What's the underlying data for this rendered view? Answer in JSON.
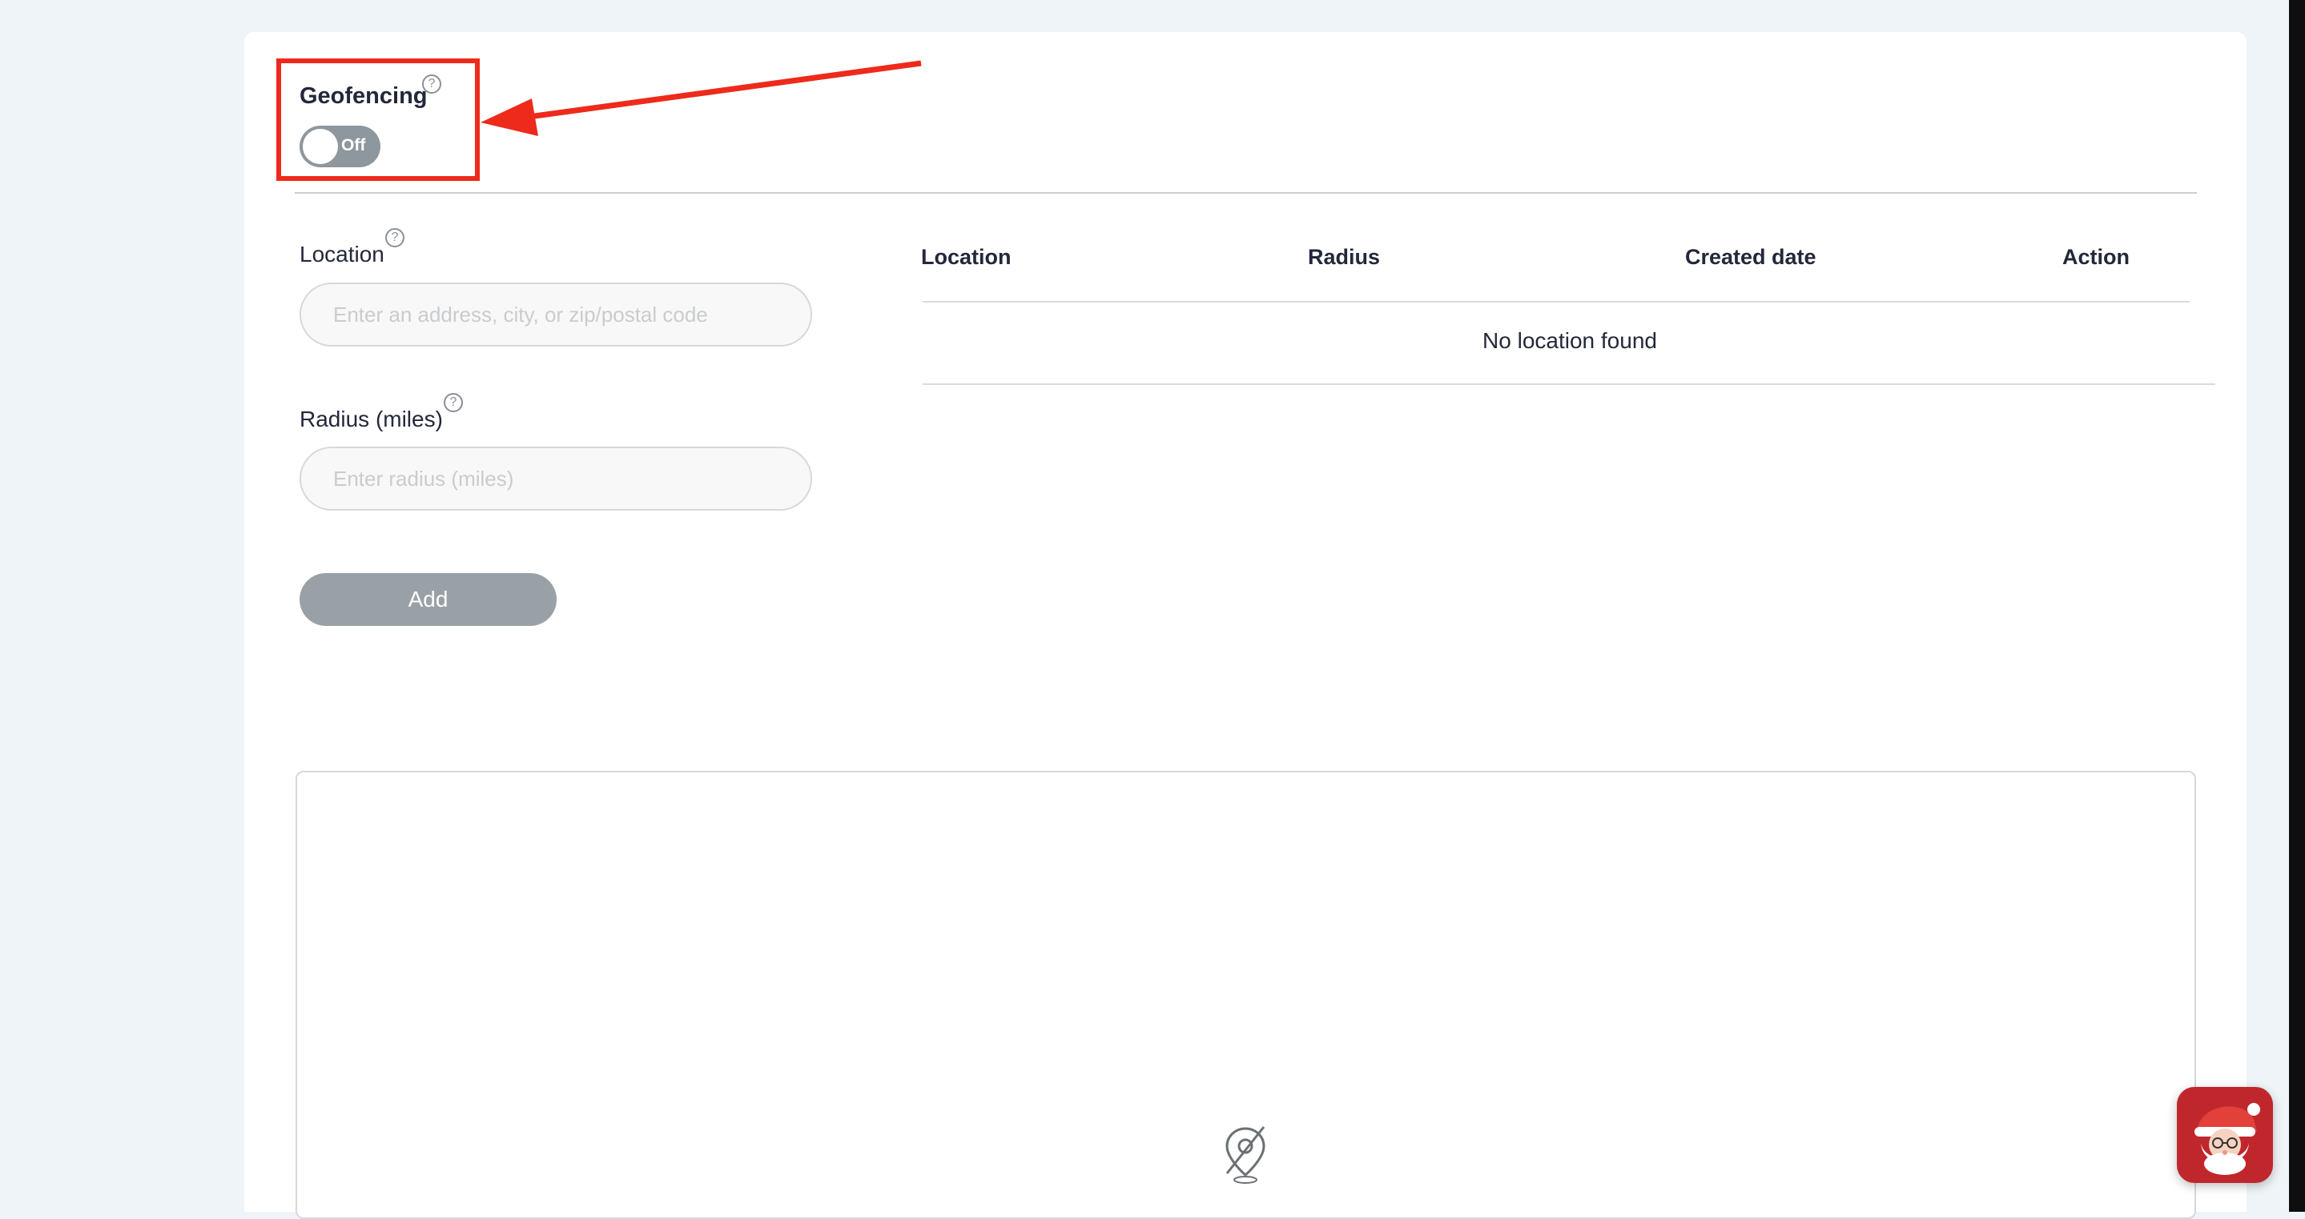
{
  "geofencing": {
    "title": "Geofencing",
    "help_glyph": "?",
    "toggle_state": "Off"
  },
  "form": {
    "location_label": "Location",
    "location_placeholder": "Enter an address, city, or zip/postal code",
    "radius_label": "Radius (miles)",
    "radius_placeholder": "Enter radius (miles)",
    "add_label": "Add"
  },
  "table": {
    "headers": [
      "Location",
      "Radius",
      "Created date",
      "Action"
    ],
    "empty_message": "No location found"
  },
  "icons": {
    "map": "map-pin-off-icon",
    "chat": "santa-chat-icon"
  },
  "colors": {
    "accent_highlight": "#ee2a1b",
    "toggle_off": "#8e979d",
    "button_disabled": "#9aa1a6",
    "chat_button": "#c0272d"
  }
}
